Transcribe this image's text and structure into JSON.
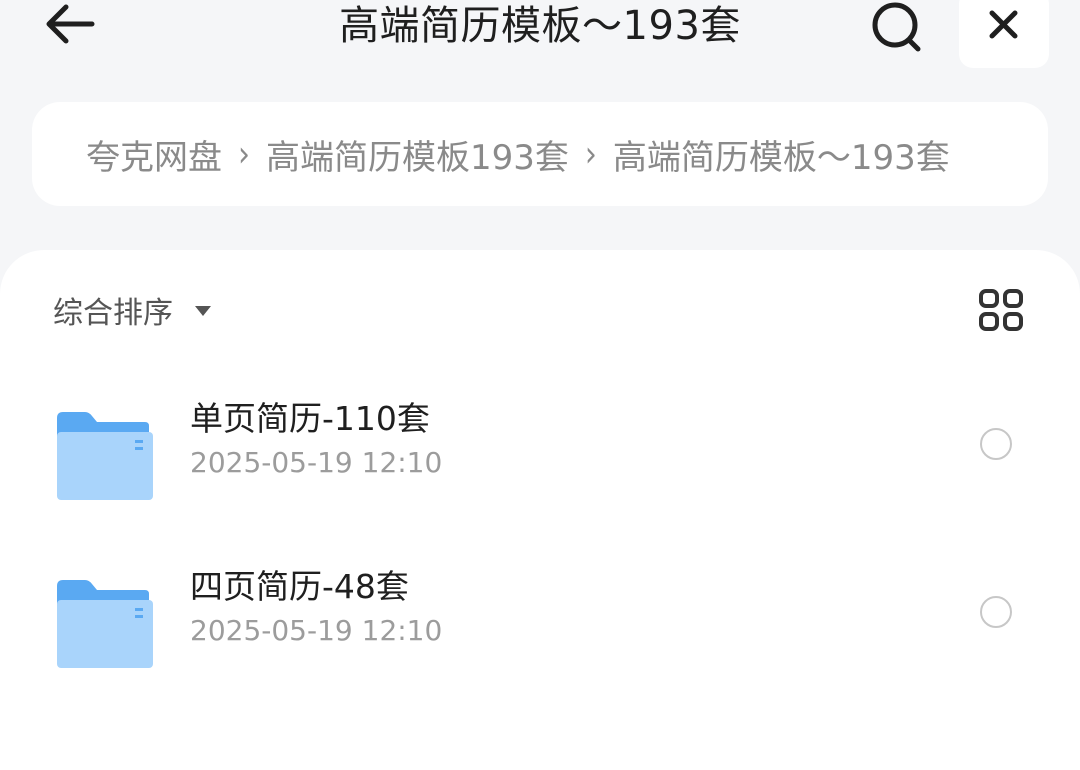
{
  "header": {
    "title": "高端简历模板～193套",
    "back_icon": "arrow-left-icon",
    "search_icon": "search-icon",
    "close_icon": "close-icon"
  },
  "breadcrumb": {
    "items": [
      {
        "label": "夸克网盘"
      },
      {
        "label": "高端简历模板193套"
      },
      {
        "label": "高端简历模板～193套"
      }
    ],
    "separator": "›"
  },
  "toolbar": {
    "sort_label": "综合排序",
    "view_icon": "grid-view-icon"
  },
  "files": [
    {
      "name": "单页简历-110套",
      "date": "2025-05-19 12:10",
      "icon": "folder-icon"
    },
    {
      "name": "四页简历-48套",
      "date": "2025-05-19 12:10",
      "icon": "folder-icon"
    }
  ],
  "colors": {
    "background": "#f5f6f8",
    "card": "#ffffff",
    "folder_back": "#5aa9f2",
    "folder_front": "#a9d4fb",
    "text_primary": "#1f1f1f",
    "text_secondary": "#9c9c9c"
  }
}
